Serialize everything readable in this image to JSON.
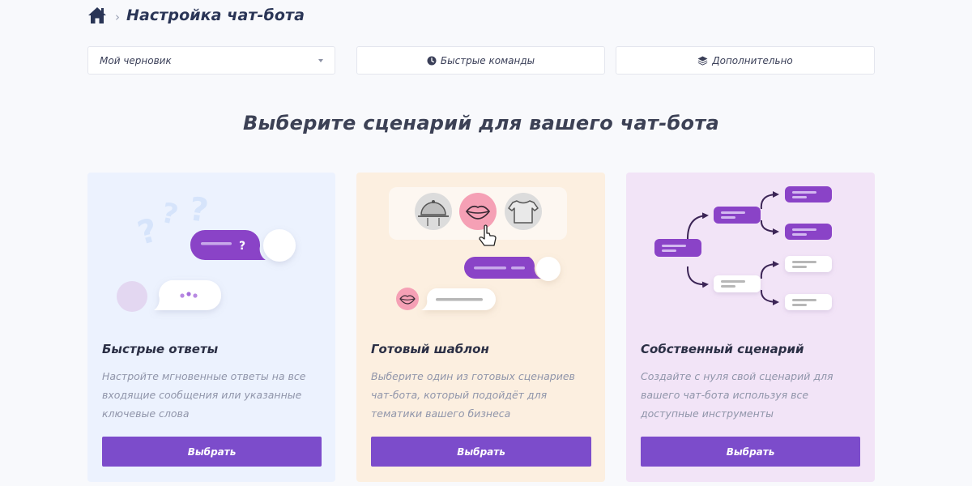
{
  "breadcrumb": {
    "separator": "›",
    "title": "Настройка чат-бота"
  },
  "toolbar": {
    "select_value": "Мой черновик",
    "quick_commands_label": "Быстрые команды",
    "advanced_label": "Дополнительно"
  },
  "heading": "Выберите сценарий для вашего чат-бота",
  "cards": [
    {
      "title": "Быстрые ответы",
      "description": "Настройте мгновенные ответы на все входящие сообщения или указанные ключевые слова",
      "button": "Выбрать"
    },
    {
      "title": "Готовый шаблон",
      "description": "Выберите один из готовых сценариев чат-бота, который подойдёт для тематики вашего бизнеса",
      "button": "Выбрать"
    },
    {
      "title": "Собственный сценарий",
      "description": "Создайте с нуля свой сценарий для вашего чат-бота используя все доступные инструменты",
      "button": "Выбрать"
    }
  ],
  "illustration_texts": {
    "question_mark": "?"
  },
  "icons": {
    "home": "home-icon",
    "quick_commands": "clock-icon",
    "advanced": "layers-icon",
    "dropdown": "caret-down-icon"
  },
  "colors": {
    "accent": "#7c4ccb",
    "page_bg": "#f8f9fc",
    "card_blue": "#ecf2fe",
    "card_peach": "#fcefe0",
    "card_lilac": "#f2e4f7",
    "title": "#2a3556",
    "muted_text": "#9095aa"
  }
}
